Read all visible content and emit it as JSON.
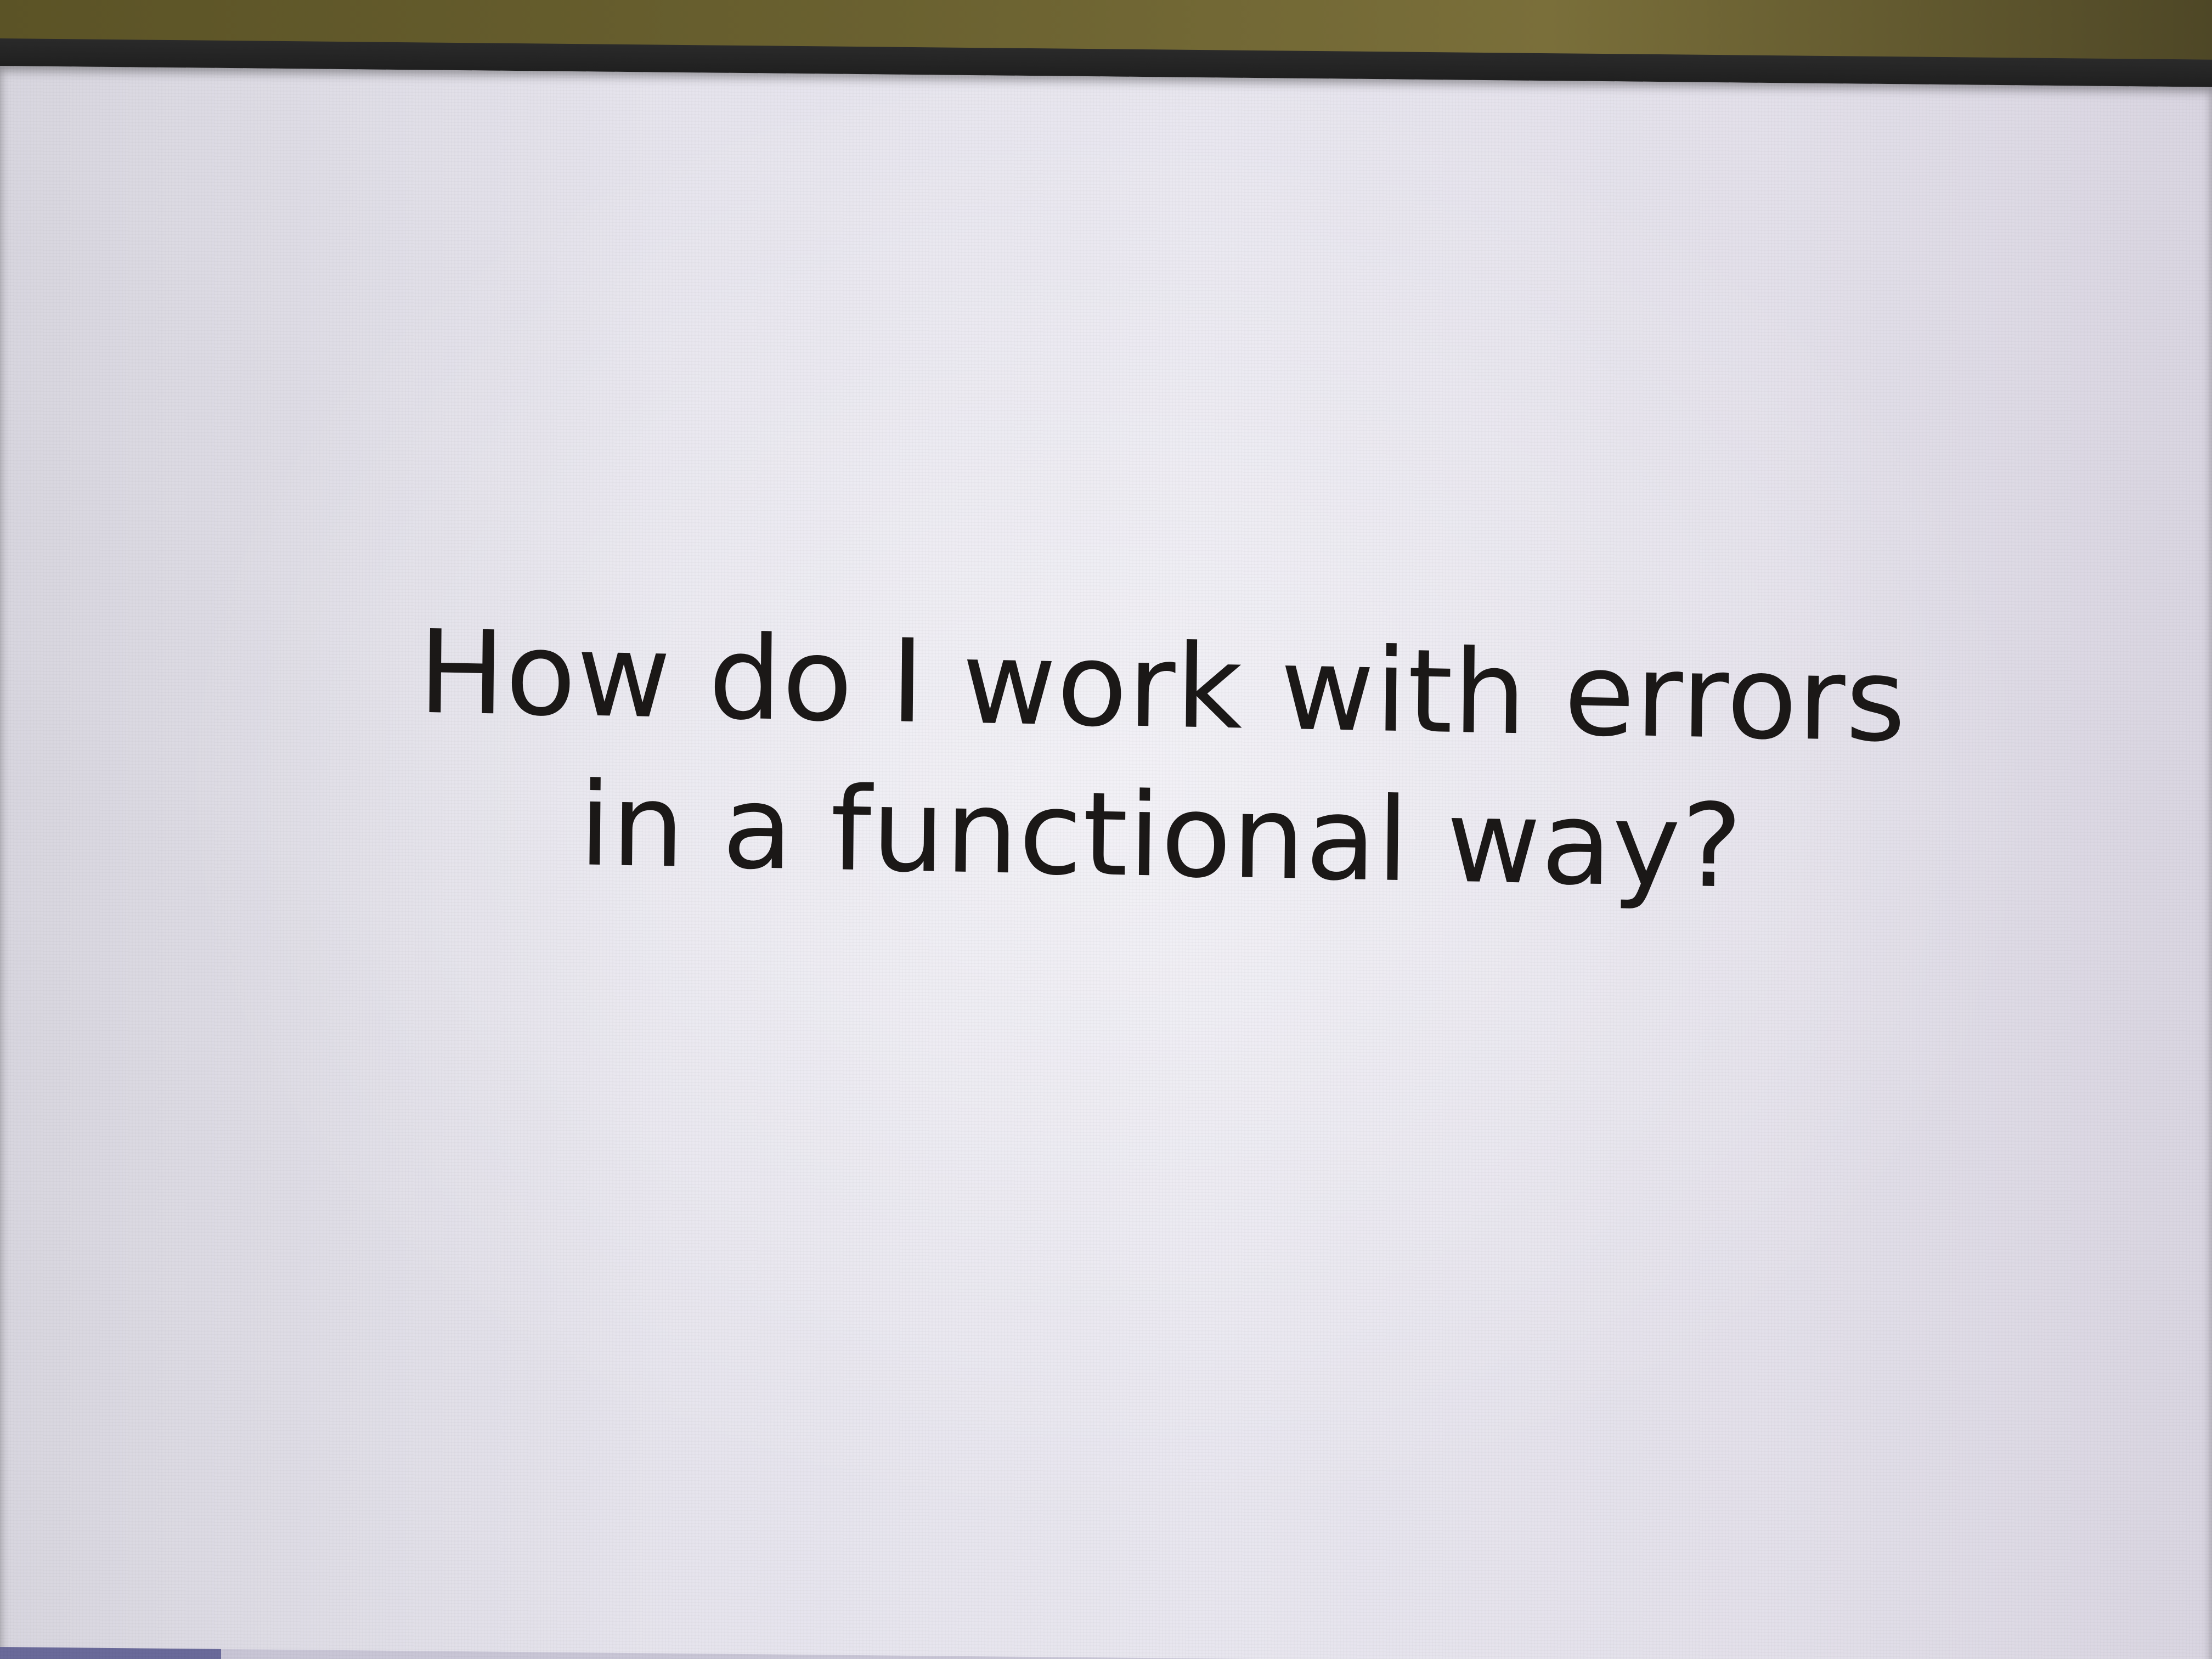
{
  "slide": {
    "title_line_1": "How do I work with errors",
    "title_line_2": "in a functional way?"
  },
  "progress": {
    "fraction": 0.1
  },
  "colors": {
    "text": "#1b1817",
    "screen_background": "#e6e4ed",
    "progress_fill": "#6a6a9a"
  }
}
